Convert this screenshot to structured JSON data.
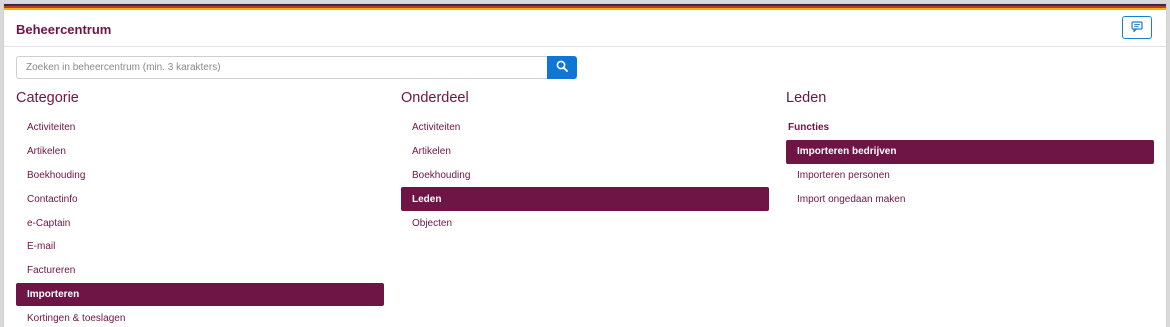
{
  "colors": {
    "brand": "#6e1545",
    "accent": "#0f76d4",
    "stripe": [
      "#3b2a4a",
      "#c0392b",
      "#f1b400"
    ]
  },
  "header": {
    "title": "Beheercentrum",
    "feedback_icon": "comment-icon"
  },
  "search": {
    "placeholder": "Zoeken in beheercentrum (min. 3 karakters)",
    "value": "",
    "button_icon": "search-icon"
  },
  "columns": {
    "categorie": {
      "heading": "Categorie",
      "items": [
        {
          "label": "Activiteiten",
          "active": false
        },
        {
          "label": "Artikelen",
          "active": false
        },
        {
          "label": "Boekhouding",
          "active": false
        },
        {
          "label": "Contactinfo",
          "active": false
        },
        {
          "label": "e-Captain",
          "active": false
        },
        {
          "label": "E-mail",
          "active": false
        },
        {
          "label": "Factureren",
          "active": false
        },
        {
          "label": "Importeren",
          "active": true
        },
        {
          "label": "Kortingen & toeslagen",
          "active": false
        }
      ]
    },
    "onderdeel": {
      "heading": "Onderdeel",
      "items": [
        {
          "label": "Activiteiten",
          "active": false
        },
        {
          "label": "Artikelen",
          "active": false
        },
        {
          "label": "Boekhouding",
          "active": false
        },
        {
          "label": "Leden",
          "active": true
        },
        {
          "label": "Objecten",
          "active": false
        }
      ]
    },
    "leden": {
      "heading": "Leden",
      "group_label": "Functies",
      "items": [
        {
          "label": "Importeren bedrijven",
          "active": true
        },
        {
          "label": "Importeren personen",
          "active": false
        },
        {
          "label": "Import ongedaan maken",
          "active": false
        }
      ]
    }
  }
}
